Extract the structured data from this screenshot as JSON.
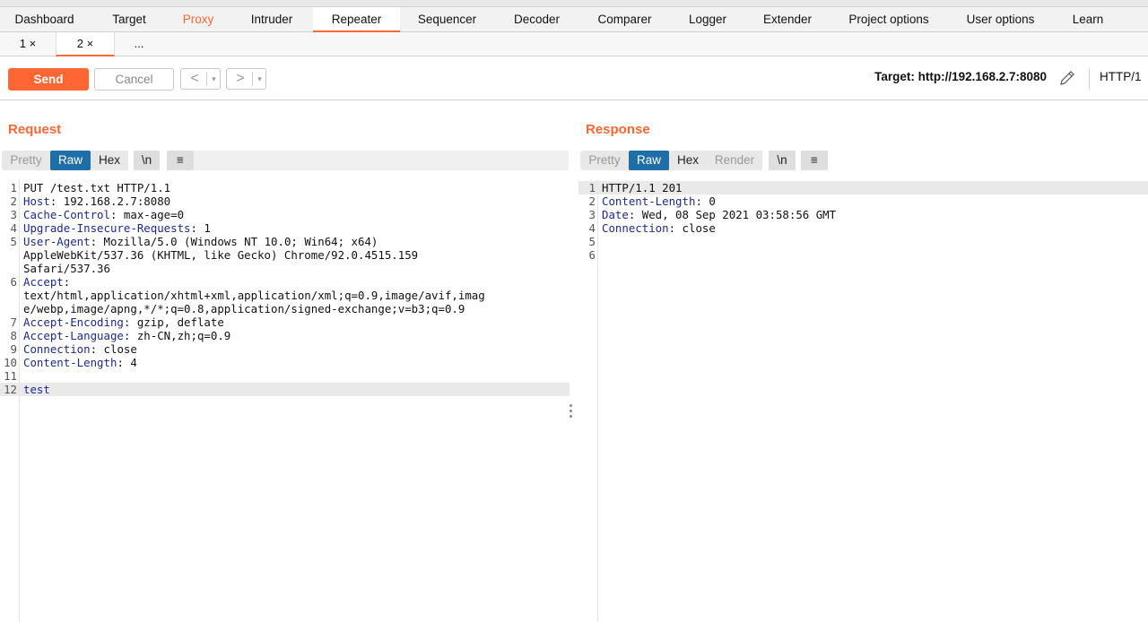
{
  "main_tabs": [
    "Dashboard",
    "Target",
    "Proxy",
    "Intruder",
    "Repeater",
    "Sequencer",
    "Decoder",
    "Comparer",
    "Logger",
    "Extender",
    "Project options",
    "User options",
    "Learn"
  ],
  "sub_tabs": [
    {
      "label": "1 ×"
    },
    {
      "label": "2 ×"
    },
    {
      "label": "..."
    }
  ],
  "toolbar": {
    "send": "Send",
    "cancel": "Cancel",
    "back_arrow": "<",
    "forward_arrow": ">",
    "drop_arrow": "▾",
    "target": "Target: http://192.168.2.7:8080",
    "protocol": "HTTP/1"
  },
  "request": {
    "title": "Request",
    "modes": [
      "Pretty",
      "Raw",
      "Hex",
      "\\n",
      "≡"
    ],
    "lines": [
      {
        "n": "1",
        "name": "",
        "rest": "PUT /test.txt HTTP/1.1"
      },
      {
        "n": "2",
        "name": "Host",
        "rest": ": 192.168.2.7:8080"
      },
      {
        "n": "3",
        "name": "Cache-Control",
        "rest": ": max-age=0"
      },
      {
        "n": "4",
        "name": "Upgrade-Insecure-Requests",
        "rest": ": 1"
      },
      {
        "n": "5",
        "name": "User-Agent",
        "rest": ": Mozilla/5.0 (Windows NT 10.0; Win64; x64)"
      },
      {
        "n": "",
        "name": "",
        "rest": "AppleWebKit/537.36 (KHTML, like Gecko) Chrome/92.0.4515.159"
      },
      {
        "n": "",
        "name": "",
        "rest": "Safari/537.36"
      },
      {
        "n": "6",
        "name": "Accept",
        "rest": ":"
      },
      {
        "n": "",
        "name": "",
        "rest": "text/html,application/xhtml+xml,application/xml;q=0.9,image/avif,imag"
      },
      {
        "n": "",
        "name": "",
        "rest": "e/webp,image/apng,*/*;q=0.8,application/signed-exchange;v=b3;q=0.9"
      },
      {
        "n": "7",
        "name": "Accept-Encoding",
        "rest": ": gzip, deflate"
      },
      {
        "n": "8",
        "name": "Accept-Language",
        "rest": ": zh-CN,zh;q=0.9"
      },
      {
        "n": "9",
        "name": "Connection",
        "rest": ": close"
      },
      {
        "n": "10",
        "name": "Content-Length",
        "rest": ": 4"
      },
      {
        "n": "11",
        "name": "",
        "rest": ""
      },
      {
        "n": "12",
        "name": "",
        "rest": "test"
      }
    ]
  },
  "response": {
    "title": "Response",
    "modes": [
      "Pretty",
      "Raw",
      "Hex",
      "Render",
      "\\n",
      "≡"
    ],
    "lines": [
      {
        "n": "1",
        "name": "",
        "rest": "HTTP/1.1 201"
      },
      {
        "n": "2",
        "name": "Content-Length",
        "rest": ": 0"
      },
      {
        "n": "3",
        "name": "Date",
        "rest": ": Wed, 08 Sep 2021 03:58:56 GMT"
      },
      {
        "n": "4",
        "name": "Connection",
        "rest": ": close"
      },
      {
        "n": "5",
        "name": "",
        "rest": ""
      },
      {
        "n": "6",
        "name": "",
        "rest": ""
      }
    ]
  },
  "colors": {
    "accent": "#ff6633",
    "selected": "#1f6ea8",
    "header_name": "#1b2a8c"
  }
}
